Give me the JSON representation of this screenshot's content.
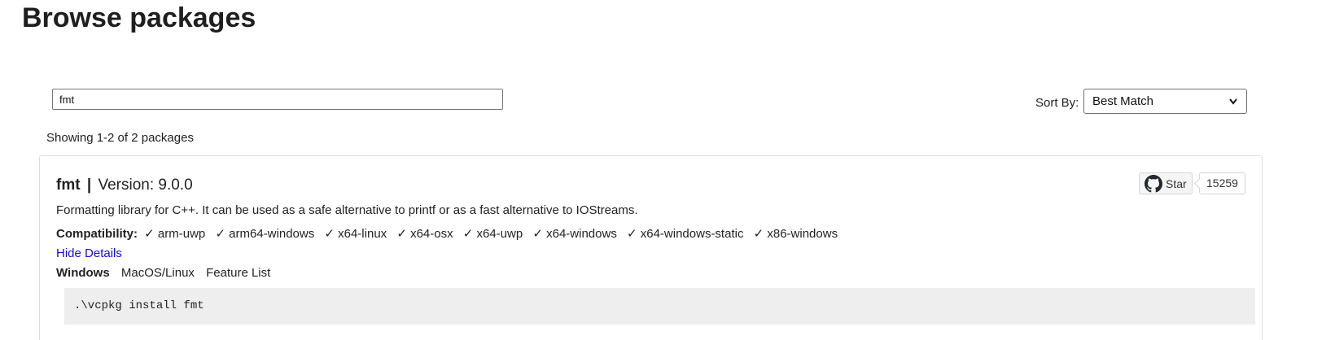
{
  "page_title": "Browse packages",
  "search": {
    "value": "fmt"
  },
  "sort": {
    "label": "Sort By:",
    "selected": "Best Match"
  },
  "result_count": "Showing 1-2 of 2 packages",
  "packages": [
    {
      "name": "fmt",
      "separator": "|",
      "version": "Version: 9.0.0",
      "description": "Formatting library for C++. It can be used as a safe alternative to printf or as a fast alternative to IOStreams.",
      "compatibility_label": "Compatibility:",
      "compatibility": [
        "✓ arm-uwp",
        "✓ arm64-windows",
        "✓ x64-linux",
        "✓ x64-osx",
        "✓ x64-uwp",
        "✓ x64-windows",
        "✓ x64-windows-static",
        "✓ x86-windows"
      ],
      "details_toggle": "Hide Details",
      "tabs": [
        "Windows",
        "MacOS/Linux",
        "Feature List"
      ],
      "active_tab": "Windows",
      "install_command": ".\\vcpkg install fmt",
      "github": {
        "star_label": "Star",
        "star_count": "15259",
        "icon": "github-icon"
      }
    }
  ],
  "colors": {
    "link": "#1a0dd9",
    "code_bg": "#eeeeee",
    "card_border": "#dcdcdc"
  }
}
